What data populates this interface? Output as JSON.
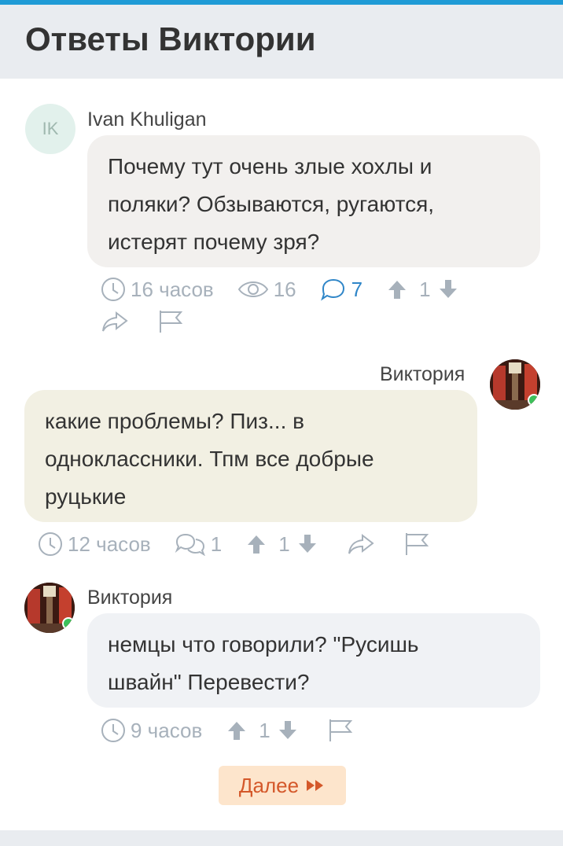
{
  "header": {
    "title": "Ответы Виктории"
  },
  "comments": [
    {
      "author": "Ivan Khuligan",
      "initials": "IK",
      "text_lines": [
        "Почему тут очень злые хохлы и",
        "поляки? Обзываются, ругаются,",
        "истерят почему зря?"
      ],
      "time": "16 часов",
      "views": "16",
      "replies": "7",
      "votes": "1"
    },
    {
      "author": "Виктория",
      "text_lines": [
        "какие проблемы? Пиз... в",
        "одноклассники. Тпм все добрые",
        "руцькие"
      ],
      "time": "12 часов",
      "replies": "1",
      "votes": "1"
    },
    {
      "author": "Виктория",
      "text_lines": [
        "немцы что говорили? \"Русишь",
        "швайн\" Перевести?"
      ],
      "time": "9 часов",
      "votes": "1"
    }
  ],
  "more_button": {
    "label": "Далее"
  },
  "colors": {
    "accent": "#1f9bd6",
    "bubble1": "#f2f0ee",
    "bubble2": "#f2f0e3",
    "bubble3": "#f0f2f5",
    "more_bg": "#fde5cc",
    "more_text": "#d4582a"
  }
}
